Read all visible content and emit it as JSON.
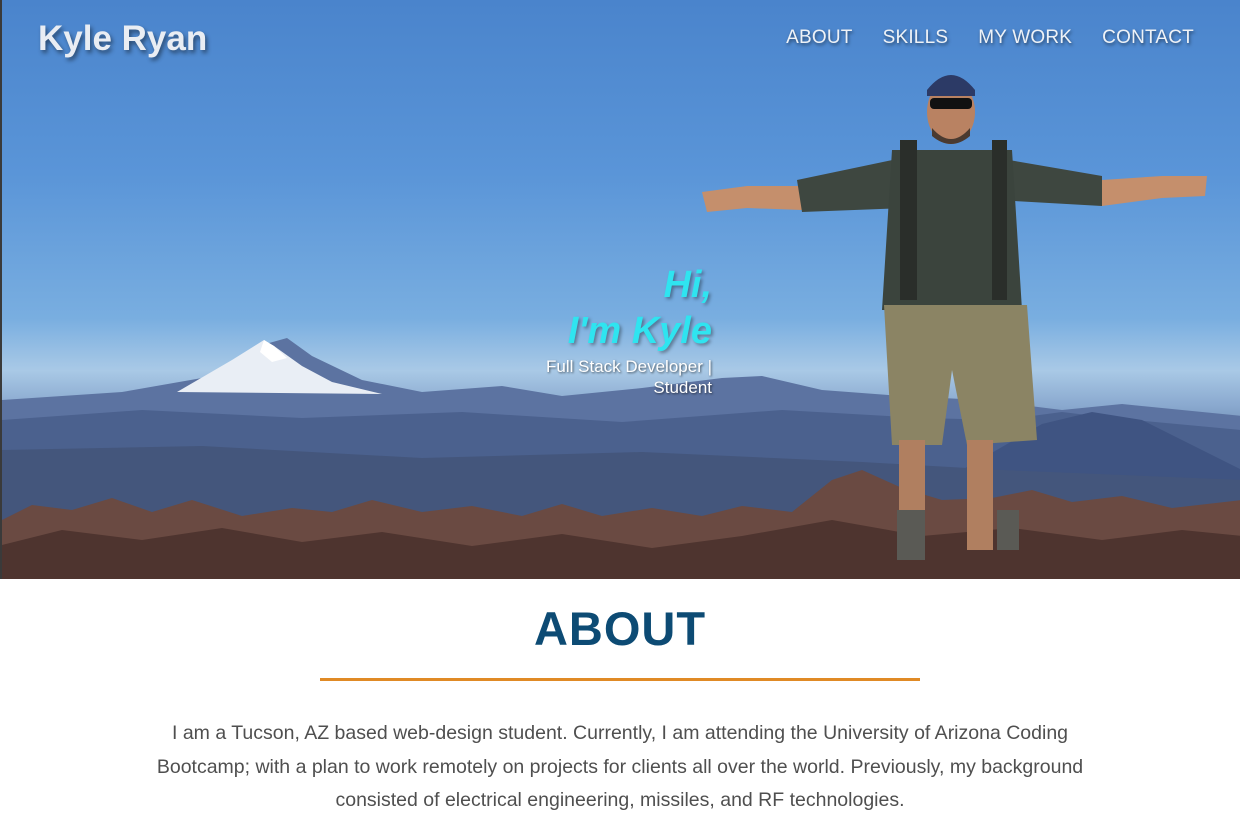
{
  "header": {
    "brand": "Kyle Ryan",
    "nav": [
      "ABOUT",
      "SKILLS",
      "MY WORK",
      "CONTACT"
    ]
  },
  "hero": {
    "greeting_line1": "Hi,",
    "greeting_line2": "I'm Kyle",
    "subtitle": "Full Stack Developer | Student",
    "image_description_icon": "hero-photo-icon"
  },
  "about": {
    "title": "ABOUT",
    "body": "I am a Tucson, AZ based web-design student. Currently, I am attending the University of Arizona Coding Bootcamp; with a plan to work remotely on projects for clients all over the world. Previously, my background consisted of electrical engineering, missiles, and RF technologies."
  },
  "colors": {
    "accent_cyan": "#2fe4f0",
    "heading_blue": "#0d4b74",
    "rule_orange": "#e08a25"
  }
}
